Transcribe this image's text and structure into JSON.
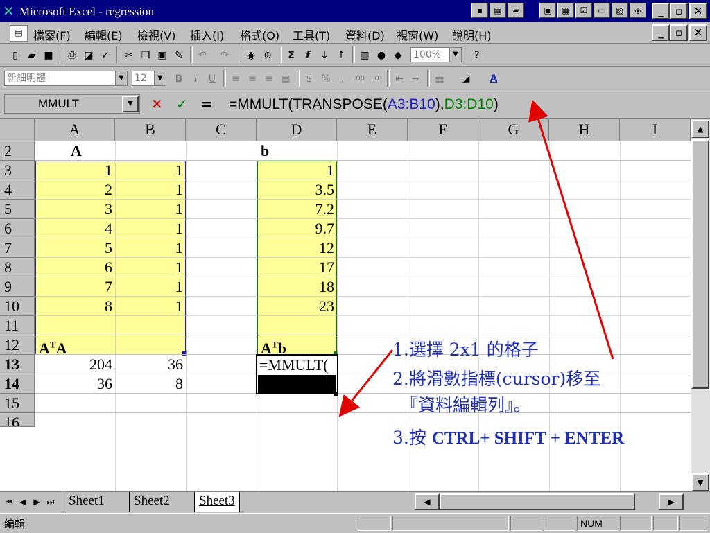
{
  "window": {
    "title": "Microsoft Excel - regression"
  },
  "menu": {
    "items": [
      "檔案(F)",
      "編輯(E)",
      "檢視(V)",
      "插入(I)",
      "格式(O)",
      "工具(T)",
      "資料(D)",
      "視窗(W)",
      "說明(H)"
    ]
  },
  "format_toolbar": {
    "font": "新細明體",
    "size": "12",
    "zoom": "100%"
  },
  "formula_bar": {
    "name_box": "MMULT",
    "formula_prefix": "=MMULT(TRANSPOSE(",
    "ref1": "A3:B10",
    "middle": "),",
    "ref2": "D3:D10",
    "suffix": ")",
    "ref1_color": "#2020c0",
    "ref2_color": "#008000"
  },
  "columns": [
    "A",
    "B",
    "C",
    "D",
    "E",
    "F",
    "G",
    "H",
    "I"
  ],
  "rows": [
    "2",
    "3",
    "4",
    "5",
    "6",
    "7",
    "8",
    "9",
    "10",
    "11",
    "12",
    "13",
    "14",
    "15",
    "16"
  ],
  "cells": {
    "A2": "A",
    "D2": "b",
    "A_col": [
      "1",
      "2",
      "3",
      "4",
      "5",
      "6",
      "7",
      "8"
    ],
    "B_col": [
      "1",
      "1",
      "1",
      "1",
      "1",
      "1",
      "1",
      "1"
    ],
    "D_col": [
      "1",
      "3.5",
      "7.2",
      "9.7",
      "12",
      "17",
      "18",
      "23"
    ],
    "A12": "ATA",
    "D12": "ATb",
    "A13": "204",
    "B13": "36",
    "A14": "36",
    "B14": "8",
    "D13": "=MMULT("
  },
  "sheet_tabs": [
    "Sheet1",
    "Sheet2",
    "Sheet3"
  ],
  "active_sheet": "Sheet3",
  "status": {
    "mode": "編輯",
    "num": "NUM"
  },
  "annotations": {
    "step1": "1.選擇 2x1 的格子",
    "step2": "2.將滑數指標(cursor)移至",
    "step2b": "『資料編輯列』。",
    "step3_prefix": "3.按 ",
    "step3_keys": "CTRL+ SHIFT + ENTER",
    "arrow_color": "#e00000"
  }
}
